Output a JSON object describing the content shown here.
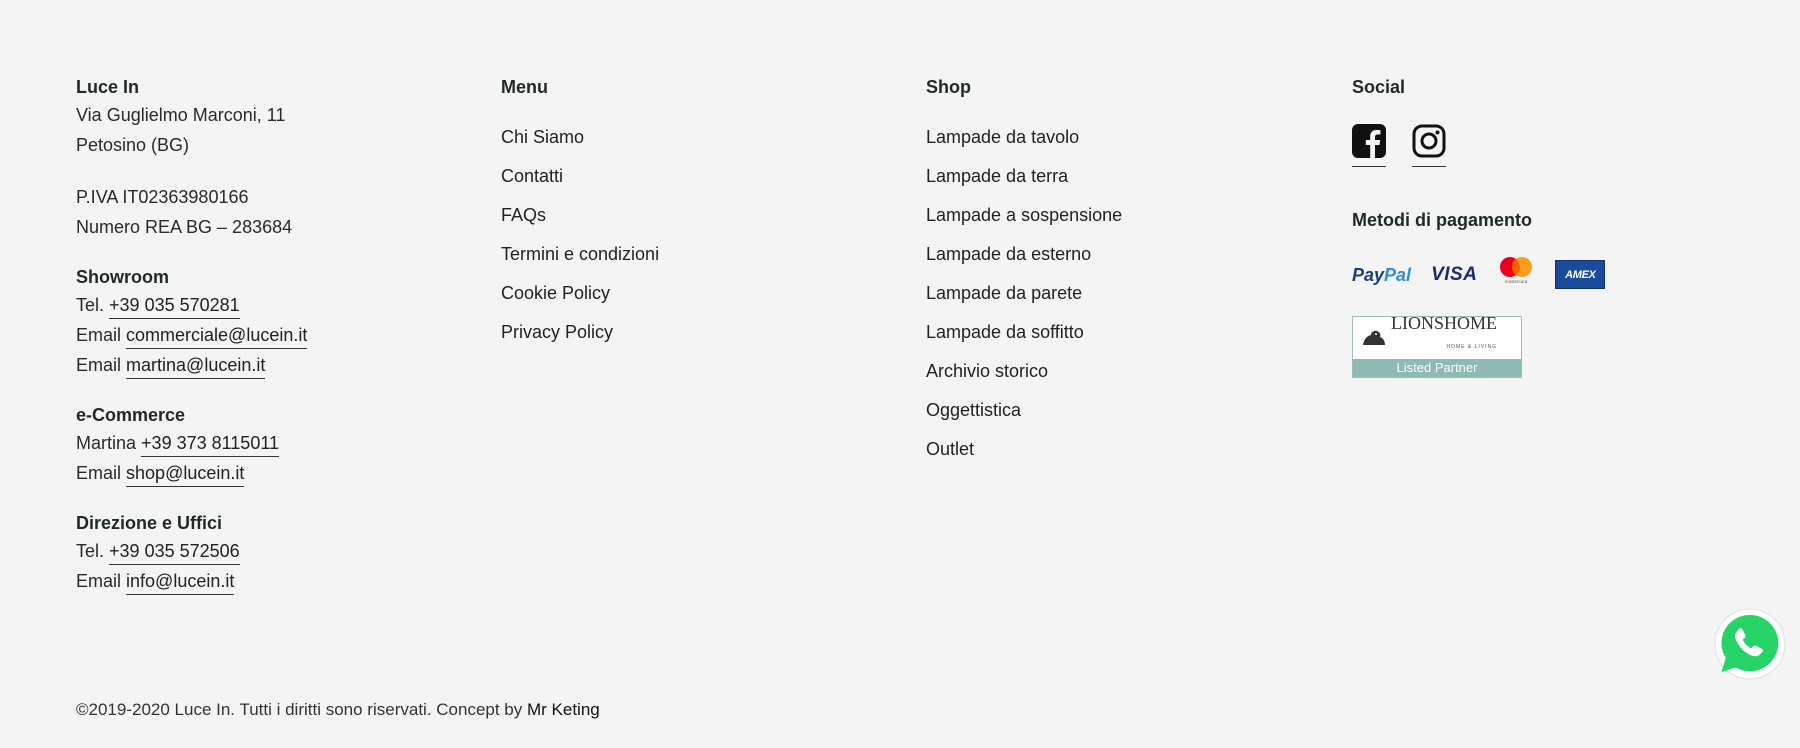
{
  "company": {
    "name": "Luce In",
    "address_line1": "Via Guglielmo Marconi, 11",
    "address_line2": "Petosino (BG)",
    "piva": "P.IVA IT02363980166",
    "rea": "Numero REA BG – 283684"
  },
  "showroom": {
    "title": "Showroom",
    "tel_label": "Tel.",
    "tel": "+39 035 570281",
    "email_label_1": "Email",
    "email_1": "commerciale@lucein.it",
    "email_label_2": "Email",
    "email_2": "martina@lucein.it"
  },
  "ecommerce": {
    "title": "e-Commerce",
    "contact_label": "Martina",
    "phone": "+39 373 8115011",
    "email_label": "Email",
    "email": "shop@lucein.it"
  },
  "office": {
    "title": "Direzione e Uffici",
    "tel_label": "Tel.",
    "tel": "+39 035 572506",
    "email_label": "Email",
    "email": "info@lucein.it"
  },
  "menu": {
    "title": "Menu",
    "items": [
      "Chi Siamo",
      "Contatti",
      "FAQs",
      "Termini e condizioni",
      "Cookie Policy",
      "Privacy Policy"
    ]
  },
  "shop": {
    "title": "Shop",
    "items": [
      "Lampade da tavolo",
      "Lampade da terra",
      "Lampade a sospensione",
      "Lampade da esterno",
      "Lampade da parete",
      "Lampade da soffitto",
      "Archivio storico",
      "Oggettistica",
      "Outlet"
    ]
  },
  "social": {
    "title": "Social",
    "icons": [
      "facebook-icon",
      "instagram-icon"
    ]
  },
  "payments": {
    "title": "Metodi di pagamento",
    "paypal_part1": "Pay",
    "paypal_part2": "Pal",
    "visa": "VISA",
    "mastercard_caption": "mastercard",
    "amex": "AMEX"
  },
  "partner": {
    "name": "LIONSHOME",
    "sub": "HOME & LIVING",
    "badge": "Listed Partner"
  },
  "footer": {
    "copyright": "©2019-2020 Luce In. Tutti i diritti sono riservati. Concept by ",
    "credit": "Mr Keting"
  },
  "colors": {
    "background": "#f4f4f4",
    "heading": "#1f2a22",
    "whatsapp": "#25d366"
  }
}
